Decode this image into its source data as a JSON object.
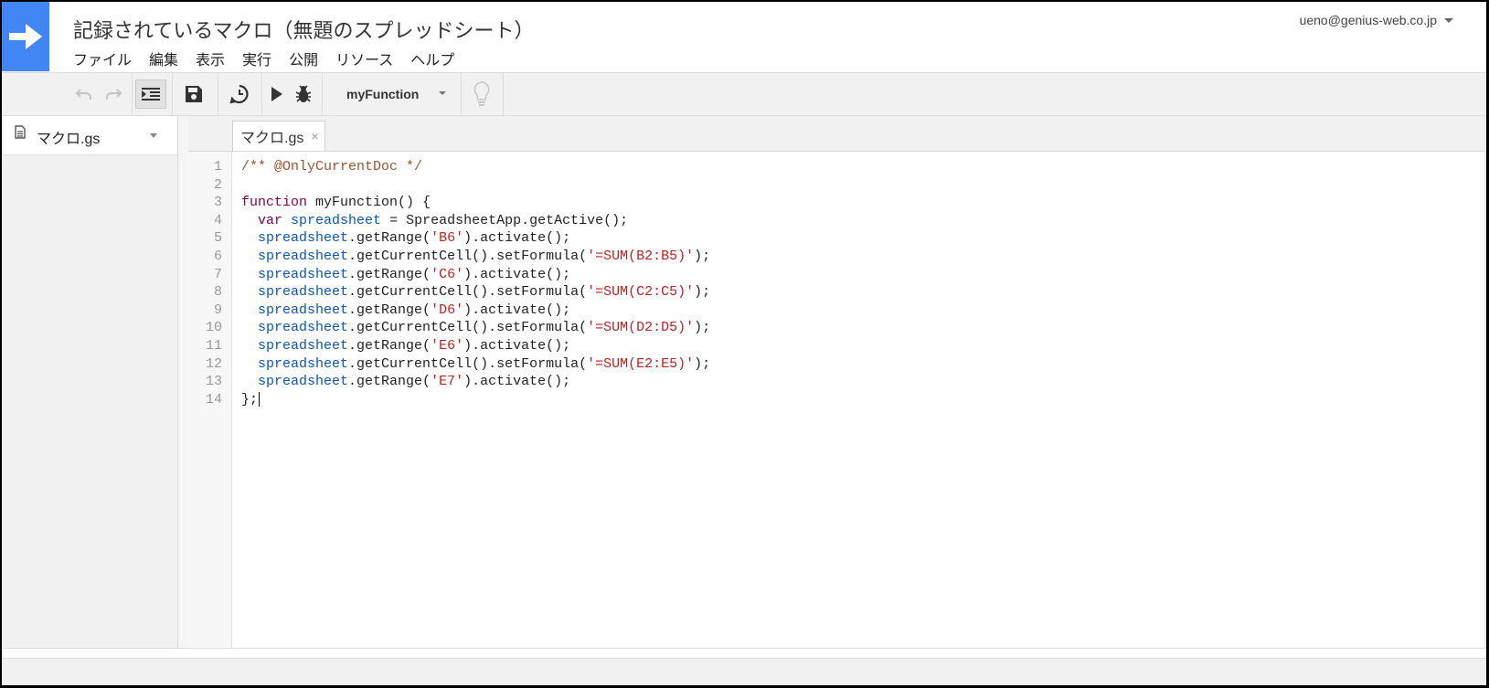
{
  "header": {
    "title": "記録されているマクロ（無題のスプレッドシート）",
    "account": "ueno@genius-web.co.jp",
    "menu": [
      "ファイル",
      "編集",
      "表示",
      "実行",
      "公開",
      "リソース",
      "ヘルプ"
    ]
  },
  "toolbar": {
    "function_select": "myFunction",
    "icons": [
      "undo-icon",
      "redo-icon",
      "indent-icon",
      "save-icon",
      "trigger-clock-icon",
      "run-icon",
      "debug-icon",
      "lightbulb-icon"
    ]
  },
  "sidebar": {
    "file_name": "マクロ.gs"
  },
  "editor": {
    "tab_label": "マクロ.gs",
    "tab_close": "×",
    "line_numbers": [
      "1",
      "2",
      "3",
      "4",
      "5",
      "6",
      "7",
      "8",
      "9",
      "10",
      "11",
      "12",
      "13",
      "14"
    ],
    "lines": [
      [
        {
          "t": "/** @OnlyCurrentDoc */",
          "c": "cm"
        }
      ],
      [],
      [
        {
          "t": "function",
          "c": "kw"
        },
        {
          "t": " myFunction() {",
          "c": ""
        }
      ],
      [
        {
          "t": "  ",
          "c": ""
        },
        {
          "t": "var",
          "c": "kw"
        },
        {
          "t": " ",
          "c": ""
        },
        {
          "t": "spreadsheet",
          "c": "vr"
        },
        {
          "t": " = SpreadsheetApp.getActive();",
          "c": ""
        }
      ],
      [
        {
          "t": "  ",
          "c": ""
        },
        {
          "t": "spreadsheet",
          "c": "vr"
        },
        {
          "t": ".getRange(",
          "c": ""
        },
        {
          "t": "'B6'",
          "c": "st"
        },
        {
          "t": ").activate();",
          "c": ""
        }
      ],
      [
        {
          "t": "  ",
          "c": ""
        },
        {
          "t": "spreadsheet",
          "c": "vr"
        },
        {
          "t": ".getCurrentCell().setFormula(",
          "c": ""
        },
        {
          "t": "'=SUM(B2:B5)'",
          "c": "st"
        },
        {
          "t": ");",
          "c": ""
        }
      ],
      [
        {
          "t": "  ",
          "c": ""
        },
        {
          "t": "spreadsheet",
          "c": "vr"
        },
        {
          "t": ".getRange(",
          "c": ""
        },
        {
          "t": "'C6'",
          "c": "st"
        },
        {
          "t": ").activate();",
          "c": ""
        }
      ],
      [
        {
          "t": "  ",
          "c": ""
        },
        {
          "t": "spreadsheet",
          "c": "vr"
        },
        {
          "t": ".getCurrentCell().setFormula(",
          "c": ""
        },
        {
          "t": "'=SUM(C2:C5)'",
          "c": "st"
        },
        {
          "t": ");",
          "c": ""
        }
      ],
      [
        {
          "t": "  ",
          "c": ""
        },
        {
          "t": "spreadsheet",
          "c": "vr"
        },
        {
          "t": ".getRange(",
          "c": ""
        },
        {
          "t": "'D6'",
          "c": "st"
        },
        {
          "t": ").activate();",
          "c": ""
        }
      ],
      [
        {
          "t": "  ",
          "c": ""
        },
        {
          "t": "spreadsheet",
          "c": "vr"
        },
        {
          "t": ".getCurrentCell().setFormula(",
          "c": ""
        },
        {
          "t": "'=SUM(D2:D5)'",
          "c": "st"
        },
        {
          "t": ");",
          "c": ""
        }
      ],
      [
        {
          "t": "  ",
          "c": ""
        },
        {
          "t": "spreadsheet",
          "c": "vr"
        },
        {
          "t": ".getRange(",
          "c": ""
        },
        {
          "t": "'E6'",
          "c": "st"
        },
        {
          "t": ").activate();",
          "c": ""
        }
      ],
      [
        {
          "t": "  ",
          "c": ""
        },
        {
          "t": "spreadsheet",
          "c": "vr"
        },
        {
          "t": ".getCurrentCell().setFormula(",
          "c": ""
        },
        {
          "t": "'=SUM(E2:E5)'",
          "c": "st"
        },
        {
          "t": ");",
          "c": ""
        }
      ],
      [
        {
          "t": "  ",
          "c": ""
        },
        {
          "t": "spreadsheet",
          "c": "vr"
        },
        {
          "t": ".getRange(",
          "c": ""
        },
        {
          "t": "'E7'",
          "c": "st"
        },
        {
          "t": ").activate();",
          "c": ""
        }
      ],
      [
        {
          "t": "};",
          "c": ""
        }
      ]
    ]
  },
  "colors": {
    "brand": "#4285f4",
    "comment": "#a0522d",
    "keyword": "#7f0055",
    "variable": "#0b56b5",
    "string": "#b22222"
  }
}
